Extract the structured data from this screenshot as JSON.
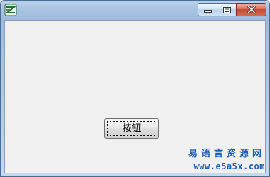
{
  "window": {
    "title": "",
    "icon": "app-logo-icon",
    "caption_buttons": [
      "minimize-icon",
      "maximize-icon",
      "close-icon"
    ],
    "client_background": "#f0f0f0"
  },
  "button": {
    "label": "按钮"
  },
  "watermark": {
    "site_name": "易语言资源网",
    "url": "www.e5a5x.com",
    "color": "#1f5fb3"
  }
}
